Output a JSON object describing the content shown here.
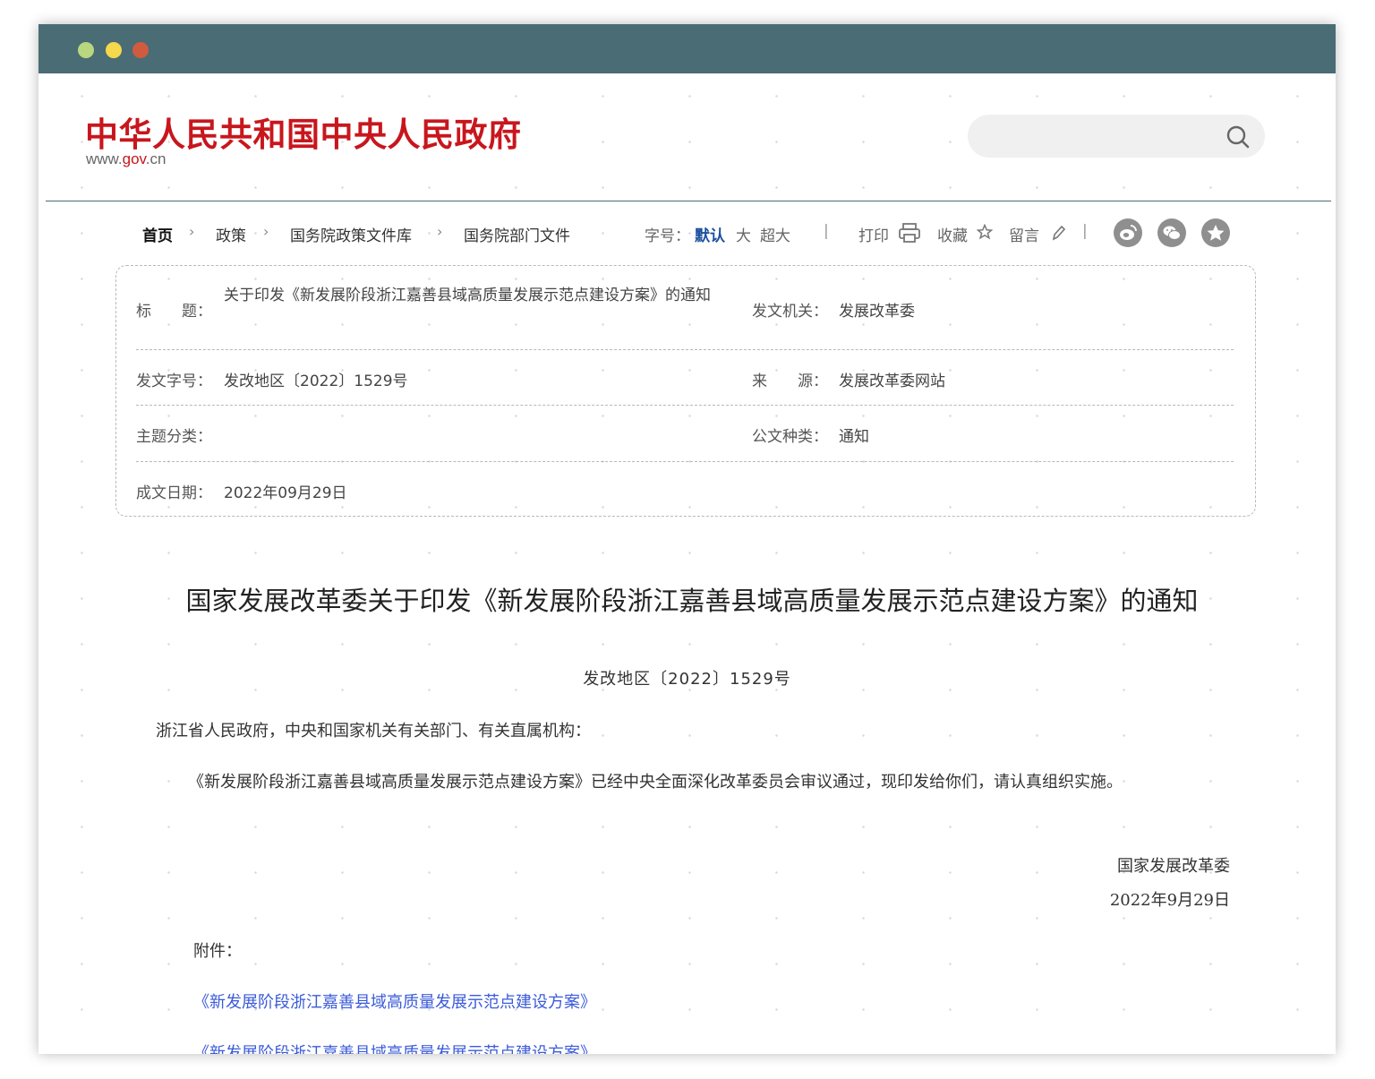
{
  "header": {
    "logo_text": "中华人民共和国中央人民政府",
    "logo_url_prefix": "www.",
    "logo_url_gov": "gov",
    "logo_url_suffix": ".cn",
    "search_placeholder": "",
    "brand_red": "#c8161d"
  },
  "nav": {
    "breadcrumb": [
      "首页",
      "政策",
      "国务院政策文件库",
      "国务院部门文件"
    ],
    "font_size_label": "字号：",
    "font_sizes": [
      "默认",
      "大",
      "超大"
    ],
    "print_label": "打印",
    "favorite_label": "收藏",
    "comment_label": "留言",
    "social_icons": [
      "weibo-icon",
      "wechat-icon",
      "qzone-icon"
    ]
  },
  "meta": {
    "title_label": "标　　题：",
    "title_value": "关于印发《新发展阶段浙江嘉善县域高质量发展示范点建设方案》的通知",
    "issuer_label": "发文机关：",
    "issuer_value": "发展改革委",
    "doc_number_label": "发文字号：",
    "doc_number_value": "发改地区〔2022〕1529号",
    "source_label": "来　　源：",
    "source_value": "发展改革委网站",
    "topic_label": "主题分类：",
    "topic_value": "",
    "doc_type_label": "公文种类：",
    "doc_type_value": "通知",
    "date_label": "成文日期：",
    "date_value": "2022年09月29日"
  },
  "document": {
    "title": "国家发展改革委关于印发《新发展阶段浙江嘉善县域高质量发展示范点建设方案》的通知",
    "number": "发改地区〔2022〕1529号",
    "greeting": "浙江省人民政府，中央和国家机关有关部门、有关直属机构：",
    "body": "《新发展阶段浙江嘉善县域高质量发展示范点建设方案》已经中央全面深化改革委员会审议通过，现印发给你们，请认真组织实施。",
    "signature": "国家发展改革委",
    "sign_date": "2022年9月29日",
    "attachment_label": "附件：",
    "attachments": [
      "《新发展阶段浙江嘉善县域高质量发展示范点建设方案》",
      "《新发展阶段浙江嘉善县域高质量发展示范点建设方案》"
    ],
    "link_color": "#3b5bd9"
  }
}
